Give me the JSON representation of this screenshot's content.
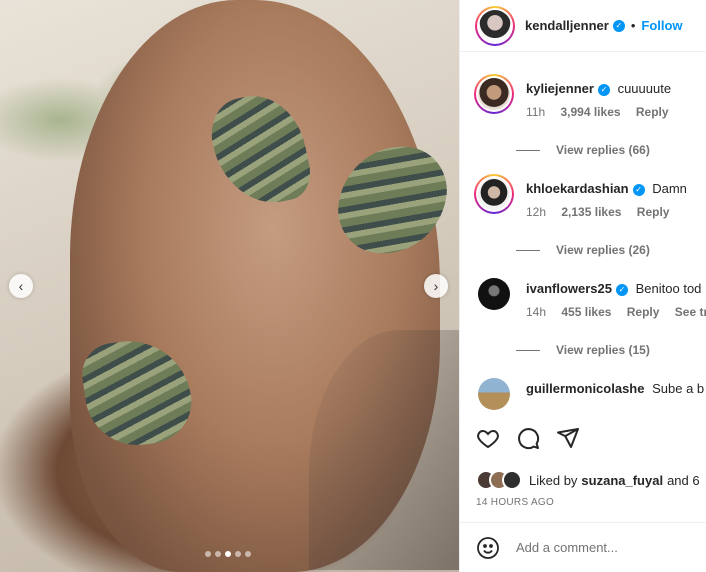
{
  "post": {
    "author": "kendalljenner",
    "follow_label": "Follow",
    "separator": "•",
    "timestamp": "14 HOURS AGO"
  },
  "carousel": {
    "prev_icon": "‹",
    "next_icon": "›",
    "slide_count": 5,
    "active_slide": 3
  },
  "comments": [
    {
      "username": "kyliejenner",
      "verified": true,
      "text": "cuuuuute",
      "age": "11h",
      "likes": "3,994 likes",
      "reply_label": "Reply",
      "view_replies": "View replies (66)"
    },
    {
      "username": "khloekardashian",
      "verified": true,
      "text": "Damn",
      "age": "12h",
      "likes": "2,135 likes",
      "reply_label": "Reply",
      "view_replies": "View replies (26)"
    },
    {
      "username": "ivanflowers25",
      "verified": true,
      "text": "Benitoo tod",
      "age": "14h",
      "likes": "455 likes",
      "reply_label": "Reply",
      "see_translation": "See trans",
      "view_replies": "View replies (15)"
    },
    {
      "username": "guillermonicolashe",
      "verified": false,
      "text": "Sube a b"
    }
  ],
  "likes": {
    "prefix": "Liked by",
    "user": "suzana_fuyal",
    "suffix": "and 6"
  },
  "composer": {
    "placeholder": "Add a comment..."
  },
  "icons": {
    "verified": "verified-badge-icon",
    "like": "heart-icon",
    "comment": "comment-bubble-icon",
    "share": "paper-plane-icon",
    "emoji": "emoji-icon"
  },
  "colors": {
    "accent": "#0095f6",
    "muted": "#737373",
    "text": "#262626"
  }
}
